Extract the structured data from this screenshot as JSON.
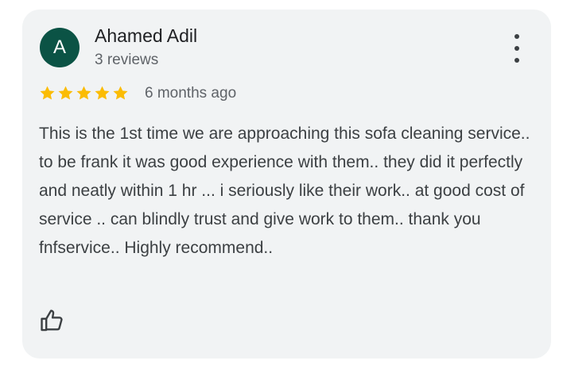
{
  "review": {
    "avatar_initial": "A",
    "reviewer_name": "Ahamed Adil",
    "review_count": "3 reviews",
    "rating": 5,
    "rating_max": 5,
    "time_ago": "6 months ago",
    "text": "This is the 1st time we are approaching this sofa cleaning service.. to be frank it was good experience with them.. they did it perfectly and neatly within 1 hr ... i seriously like their work.. at good cost of service .. can blindly trust and give work to them.. thank you fnfservice.. Highly recommend.."
  },
  "icons": {
    "menu": "more-vert-icon",
    "star": "star-icon",
    "like": "thumbs-up-icon"
  },
  "colors": {
    "avatar_bg": "#0b5345",
    "star": "#fbbc04",
    "card_bg": "#f1f3f4"
  }
}
